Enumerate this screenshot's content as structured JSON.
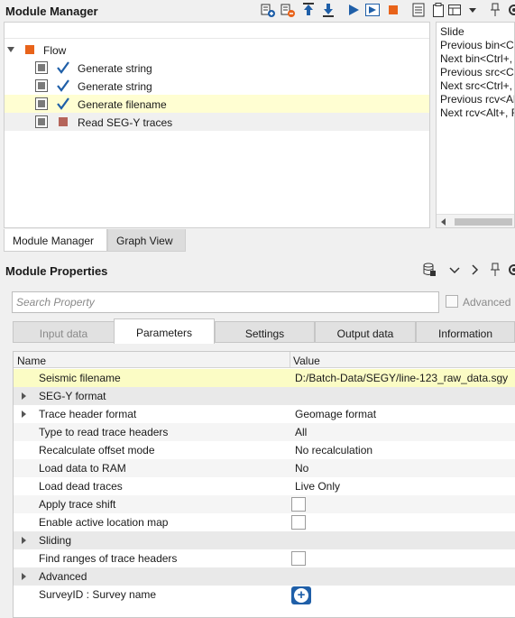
{
  "module_manager": {
    "title": "Module Manager",
    "toolbar": [
      "add-module-icon",
      "remove-module-icon",
      "move-up-icon",
      "move-down-icon",
      "run-icon",
      "run-from-selected-icon",
      "stop-icon",
      "list-icon",
      "clipboard-icon",
      "dropdown-icon",
      "pin-icon",
      "gear-icon"
    ],
    "flow": {
      "root_label": "Flow",
      "items": [
        {
          "label": "Generate string",
          "checked": true,
          "selected": false
        },
        {
          "label": "Generate string",
          "checked": true,
          "selected": false
        },
        {
          "label": "Generate filename",
          "checked": true,
          "selected": true
        },
        {
          "label": "Read SEG-Y traces",
          "checked": false,
          "selected": false
        }
      ]
    },
    "shortcuts": [
      "Slide",
      "Previous bin<Ct",
      "Next bin<Ctrl+,",
      "Previous src<Ct",
      "Next src<Ctrl+,",
      "Previous rcv<Alt",
      "Next rcv<Alt+, F"
    ],
    "tabs": [
      "Module Manager",
      "Graph View"
    ],
    "active_tab": "Module Manager"
  },
  "module_properties": {
    "title": "Module Properties",
    "search": {
      "placeholder": "Search Property",
      "value": ""
    },
    "advanced_label": "Advanced",
    "tabs": [
      "Input data",
      "Parameters",
      "Settings",
      "Output data",
      "Information"
    ],
    "active_tab": "Parameters",
    "grid": {
      "headers": {
        "name": "Name",
        "value": "Value"
      },
      "rows": [
        {
          "name": "Seismic filename",
          "value": "D:/Batch-Data/SEGY/line-123_raw_data.sgy",
          "type": "text",
          "highlight": true
        },
        {
          "name": "SEG-Y format",
          "value": "",
          "type": "group"
        },
        {
          "name": "Trace header format",
          "value": "Geomage format",
          "type": "group-value"
        },
        {
          "name": "Type to read trace headers",
          "value": "All",
          "type": "text"
        },
        {
          "name": "Recalculate offset mode",
          "value": "No recalculation",
          "type": "text"
        },
        {
          "name": "Load data to RAM",
          "value": "No",
          "type": "text"
        },
        {
          "name": "Load dead traces",
          "value": "Live Only",
          "type": "text"
        },
        {
          "name": "Apply trace shift",
          "value": "",
          "type": "checkbox"
        },
        {
          "name": "Enable active location map",
          "value": "",
          "type": "checkbox"
        },
        {
          "name": "Sliding",
          "value": "",
          "type": "group"
        },
        {
          "name": "Find ranges of trace headers",
          "value": "",
          "type": "checkbox"
        },
        {
          "name": "Advanced",
          "value": "",
          "type": "group"
        },
        {
          "name": "SurveyID : Survey name",
          "value": "",
          "type": "add"
        }
      ]
    }
  },
  "colors": {
    "selected_row": "#fffed2",
    "highlight_row": "#fbfcc5",
    "accent_blue": "#1f5fa8",
    "stop_orange": "#e8631a",
    "flow_square": "#e8631a",
    "disabled_module": "#b5645a"
  }
}
